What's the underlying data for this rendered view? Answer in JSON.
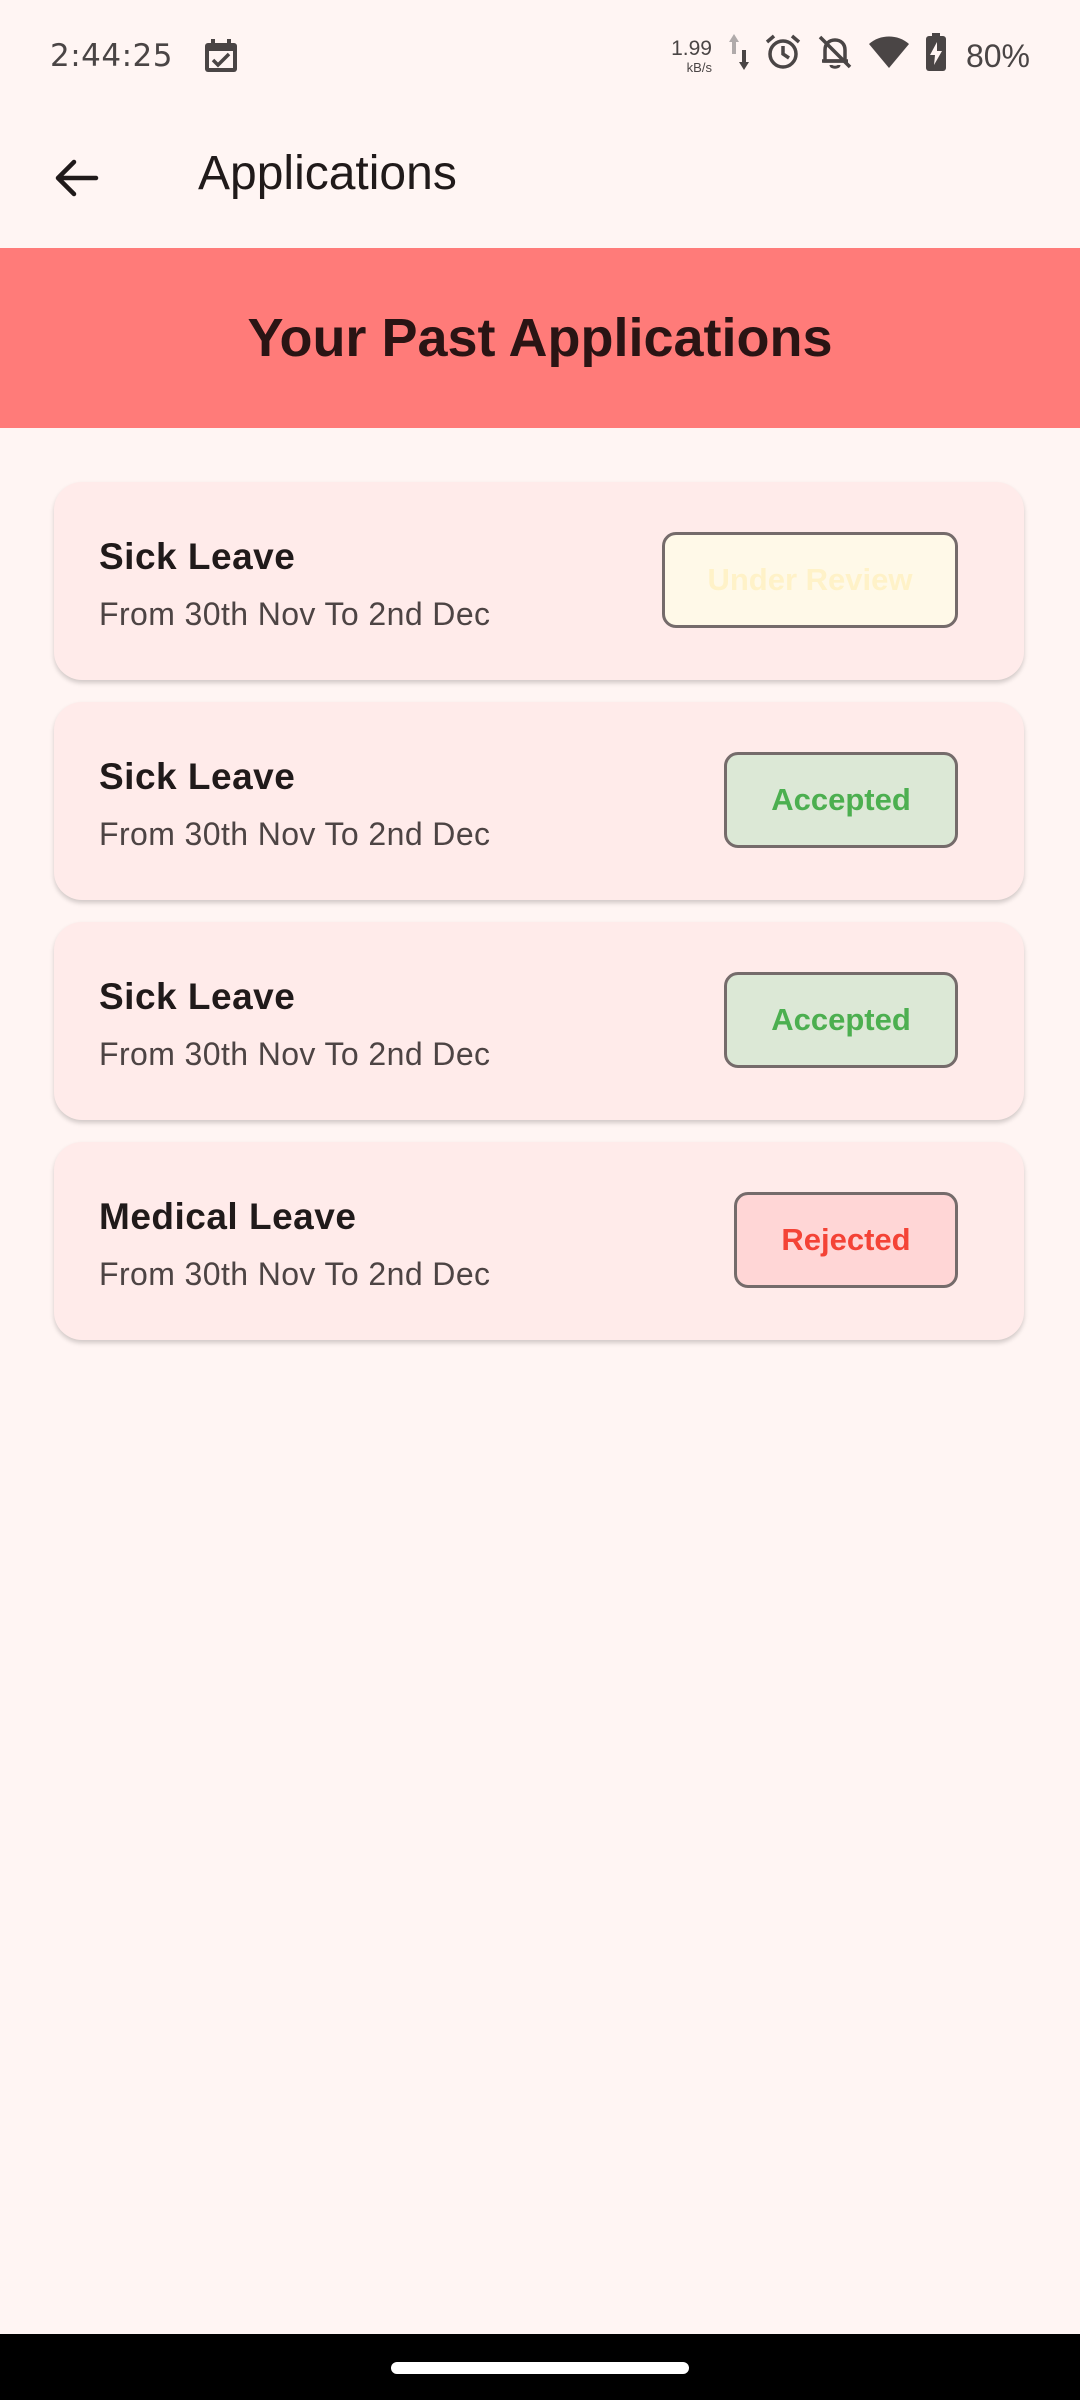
{
  "status_bar": {
    "time": "2:44:25",
    "net_speed_value": "1.99",
    "net_speed_unit": "kB/s",
    "battery_percent": "80%",
    "icons": [
      "calendar-icon",
      "data-arrows-icon",
      "alarm-icon",
      "notifications-off-icon",
      "wifi-icon",
      "battery-charging-icon"
    ]
  },
  "app_bar": {
    "title": "Applications",
    "back_icon": "arrow-back-icon"
  },
  "banner": {
    "title": "Your Past Applications",
    "color": "#ff7b79"
  },
  "applications": [
    {
      "type": "Sick Leave",
      "dates": "From 30th Nov To 2nd Dec",
      "status": "Under Review"
    },
    {
      "type": "Sick Leave",
      "dates": "From 30th Nov To 2nd Dec",
      "status": "Accepted"
    },
    {
      "type": "Sick Leave",
      "dates": "From 30th Nov To 2nd Dec",
      "status": "Accepted"
    },
    {
      "type": "Medical Leave",
      "dates": "From 30th Nov To 2nd Dec",
      "status": "Rejected"
    }
  ],
  "status_colors": {
    "under_review": "#fff2c8",
    "accepted": "#4caf50",
    "rejected": "#f44336"
  }
}
